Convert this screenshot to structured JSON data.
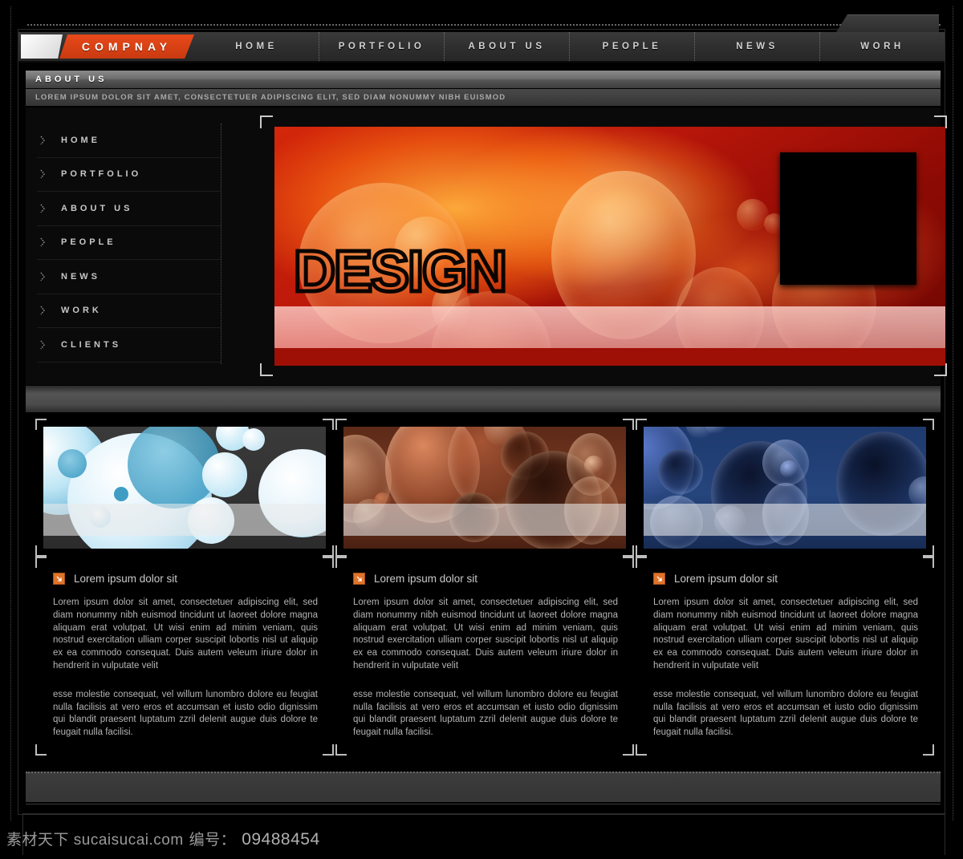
{
  "brand": {
    "name": "COMPNAY"
  },
  "nav": {
    "items": [
      {
        "label": "HOME"
      },
      {
        "label": "PORTFOLIO"
      },
      {
        "label": "ABOUT US"
      },
      {
        "label": "PEOPLE"
      },
      {
        "label": "NEWS"
      },
      {
        "label": "WORH"
      }
    ]
  },
  "page": {
    "title": "ABOUT US",
    "subtitle": "LOREM IPSUM DOLOR SIT AMET, CONSECTETUER ADIPISCING ELIT, SED DIAM NONUMMY NIBH EUISMOD"
  },
  "sidebar": {
    "items": [
      {
        "label": "HOME"
      },
      {
        "label": "PORTFOLIO"
      },
      {
        "label": "ABOUT US"
      },
      {
        "label": "PEOPLE"
      },
      {
        "label": "NEWS"
      },
      {
        "label": "WORK"
      },
      {
        "label": "CLIENTS"
      }
    ]
  },
  "hero": {
    "title": "DESIGN",
    "accent_color": "#d4270a",
    "band_color": "#f6c9c4"
  },
  "panels": [
    {
      "heading": "Lorem ipsum dolor sit",
      "icon": "arrow-down-right-icon",
      "theme_color": "#7fc6e0",
      "paragraph1": "Lorem ipsum dolor sit amet, consectetuer adipiscing elit, sed diam nonummy nibh euismod tincidunt ut laoreet dolore magna aliquam erat volutpat. Ut wisi enim ad minim veniam,  quis nostrud exercitation ulliam corper suscipit lobortis nisl ut aliquip ex ea commodo consequat. Duis autem veleum iriure dolor in hendrerit in vulputate velit",
      "paragraph2": "esse molestie consequat, vel willum lunombro dolore eu feugiat nulla facilisis at vero eros et accumsan et iusto odio dignissim qui blandit praesent luptatum zzril delenit augue duis dolore te feugait nulla facilisi."
    },
    {
      "heading": "Lorem ipsum dolor sit",
      "icon": "arrow-down-right-icon",
      "theme_color": "#c0703f",
      "paragraph1": "Lorem ipsum dolor sit amet, consectetuer adipiscing elit, sed diam nonummy nibh euismod tincidunt ut laoreet dolore magna aliquam erat volutpat. Ut wisi enim ad minim veniam,  quis nostrud exercitation ulliam corper suscipit lobortis nisl ut aliquip ex ea commodo consequat. Duis autem veleum iriure dolor in hendrerit in vulputate velit",
      "paragraph2": "esse molestie consequat, vel willum lunombro dolore eu feugiat nulla facilisis at vero eros et accumsan et iusto odio dignissim qui blandit praesent luptatum zzril delenit augue duis dolore te feugait nulla facilisi."
    },
    {
      "heading": "Lorem ipsum dolor sit",
      "icon": "arrow-down-right-icon",
      "theme_color": "#3a5fae",
      "paragraph1": "Lorem ipsum dolor sit amet, consectetuer adipiscing elit, sed diam nonummy nibh euismod tincidunt ut laoreet dolore magna aliquam erat volutpat. Ut wisi enim ad minim veniam,  quis nostrud exercitation ulliam corper suscipit lobortis nisl ut aliquip ex ea commodo consequat. Duis autem veleum iriure dolor in hendrerit in vulputate velit",
      "paragraph2": "esse molestie consequat, vel willum lunombro dolore eu feugiat nulla facilisis at vero eros et accumsan et iusto odio dignissim qui blandit praesent luptatum zzril delenit augue duis dolore te feugait nulla facilisi."
    }
  ],
  "watermark": {
    "site": "素材天下 sucaisucai.com",
    "label": "编号：",
    "number": "09488454"
  }
}
